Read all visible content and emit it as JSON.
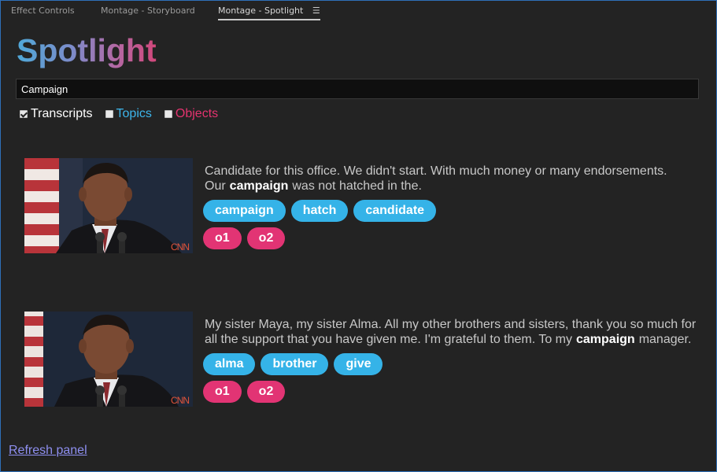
{
  "tabs": [
    {
      "label": "Effect Controls"
    },
    {
      "label": "Montage - Storyboard"
    },
    {
      "label": "Montage - Spotlight",
      "active": true,
      "menu_icon": "menu-icon"
    }
  ],
  "title": "Spotlight",
  "search": {
    "value": "Campaign",
    "placeholder": ""
  },
  "filters": [
    {
      "label": "Transcripts",
      "checked": true,
      "color": "#ffffff"
    },
    {
      "label": "Topics",
      "checked": false,
      "color": "#3db6ec"
    },
    {
      "label": "Objects",
      "checked": false,
      "color": "#e4336f"
    }
  ],
  "colors": {
    "topic_tag": "#35b3e8",
    "object_tag": "#e23474",
    "background": "#232323",
    "link": "#8e8ff0"
  },
  "results": [
    {
      "thumbnail_logo": "CNN",
      "transcript_before": "Candidate for this office. We didn't start. With much money or many endorsements. Our",
      "transcript_highlight": "campaign",
      "transcript_after": "was not hatched in the.",
      "topics": [
        "campaign",
        "hatch",
        "candidate"
      ],
      "objects": [
        "o1",
        "o2"
      ]
    },
    {
      "thumbnail_logo": "CNN",
      "transcript_before": "My sister Maya, my sister Alma. All my other brothers and sisters, thank you so much for all the support that you have given me. I'm grateful to them. To my",
      "transcript_highlight": "campaign",
      "transcript_after": "manager.",
      "topics": [
        "alma",
        "brother",
        "give"
      ],
      "objects": [
        "o1",
        "o2"
      ]
    }
  ],
  "refresh_label": "Refresh panel"
}
